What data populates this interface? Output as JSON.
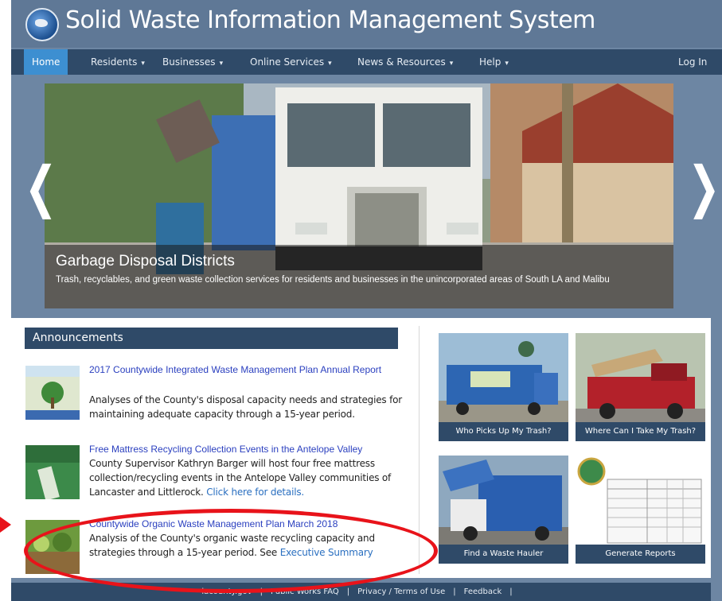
{
  "header": {
    "title": "Solid Waste Information Management System"
  },
  "nav": {
    "home": "Home",
    "residents": "Residents",
    "businesses": "Businesses",
    "online_services": "Online Services",
    "news_resources": "News & Resources",
    "help": "Help",
    "login": "Log In",
    "caret": "▾"
  },
  "hero": {
    "title": "Garbage Disposal Districts",
    "description": "Trash, recyclables, and green waste collection services for residents and businesses in the unincorporated areas of South LA and Malibu",
    "prev": "❮",
    "next": "❯"
  },
  "announcements": {
    "header": "Announcements",
    "items": [
      {
        "title": "2017 Countywide Integrated Waste Management Plan Annual Report",
        "description": "Analyses of the County's disposal capacity needs and strategies for maintaining adequate capacity through a 15-year period."
      },
      {
        "title": "Free Mattress Recycling Collection Events in the Antelope Valley",
        "description": "County Supervisor Kathryn Barger will host four free mattress collection/recycling events in the Antelope Valley communities of Lancaster and Littlerock.",
        "link": "Click here for details."
      },
      {
        "title": "Countywide Organic Waste Management Plan March 2018",
        "description": "Analysis of the County's organic waste recycling capacity and strategies through a 15-year period. See",
        "link": "Executive Summary"
      }
    ]
  },
  "tiles": [
    {
      "label": "Who Picks Up My Trash?"
    },
    {
      "label": "Where Can I Take My Trash?"
    },
    {
      "label": "Find a Waste Hauler"
    },
    {
      "label": "Generate Reports"
    }
  ],
  "footer": {
    "links": [
      "lacounty.gov",
      "Public Works FAQ",
      "Privacy / Terms of Use",
      "Feedback"
    ],
    "separator": "|"
  }
}
